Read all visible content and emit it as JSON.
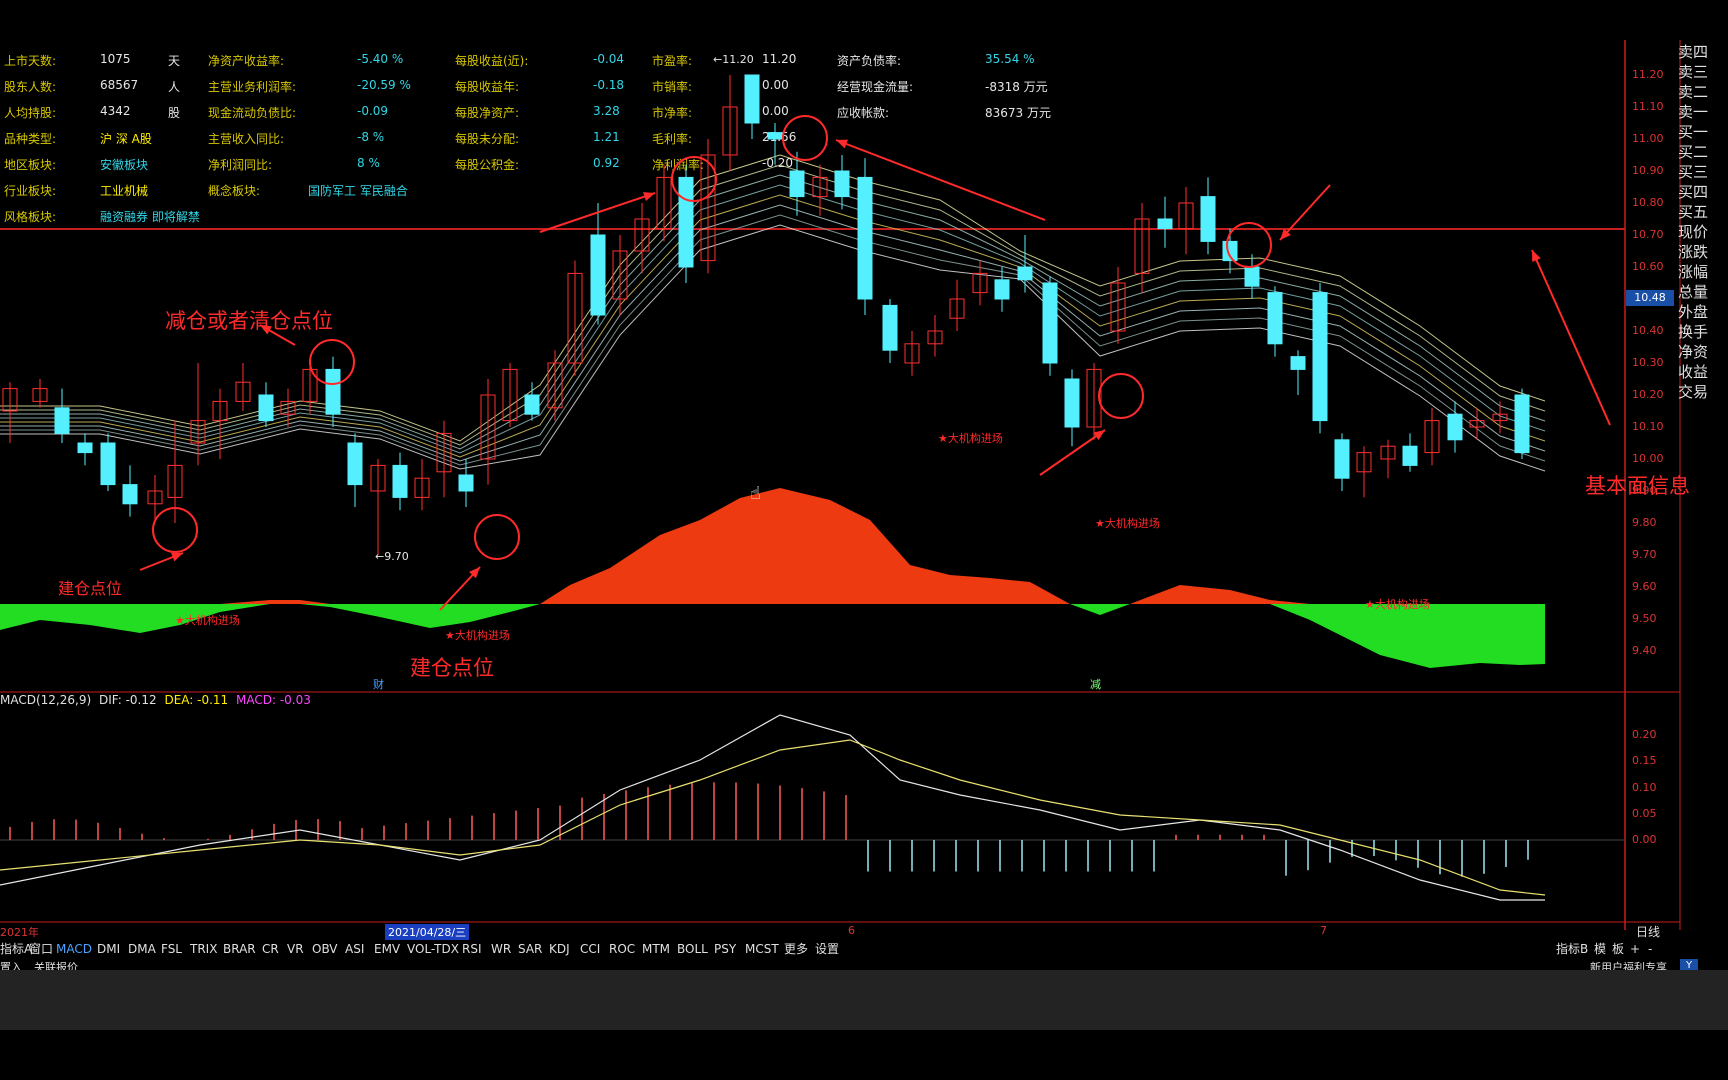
{
  "info_rows": [
    {
      "l1": "上市天数:",
      "v1": "1075",
      "u1": "天",
      "l2": "净资产收益率:",
      "v2": "-5.40 %",
      "l3": "每股收益(近):",
      "v3": "-0.04",
      "l4": "市盈率:",
      "v4": "11.20",
      "l5": "资产负债率:",
      "v5": "35.54 %"
    },
    {
      "l1": "股东人数:",
      "v1": "68567",
      "u1": "人",
      "l2": "主营业务利润率:",
      "v2": "-20.59 %",
      "l3": "每股收益年:",
      "v3": "-0.18",
      "l4": "市销率:",
      "v4": "0.00",
      "l5": "经营现金流量:",
      "v5": "-8318 万元"
    },
    {
      "l1": "人均持股:",
      "v1": "4342",
      "u1": "股",
      "l2": "现金流动负债比:",
      "v2": "-0.09",
      "l3": "每股净资产:",
      "v3": "3.28",
      "l4": "市净率:",
      "v4": "0.00",
      "l5": "应收帐款:",
      "v5": "83673 万元"
    },
    {
      "l1": "品种类型:",
      "v1": "沪 深 A股",
      "u1": "",
      "l2": "主营收入同比:",
      "v2": "-8 %",
      "l3": "每股未分配:",
      "v3": "1.21",
      "l4": "毛利率:",
      "v4": "21.56",
      "l5": "",
      "v5": ""
    },
    {
      "l1": "地区板块:",
      "v1": "安徽板块",
      "u1": "",
      "l2": "净利润同比:",
      "v2": "8 %",
      "l3": "每股公积金:",
      "v3": "0.92",
      "l4": "净利润率:",
      "v4": "-0.20",
      "l5": "",
      "v5": ""
    },
    {
      "l1": "行业板块:",
      "v1": "工业机械",
      "u1": "",
      "l2": "概念板块:",
      "v2": "国防军工 军民融合",
      "l3": "",
      "v3": "",
      "l4": "",
      "v4": "",
      "l5": "",
      "v5": ""
    },
    {
      "l1": "风格板块:",
      "v1": "融资融券 即将解禁",
      "u1": "",
      "l2": "",
      "v2": "",
      "l3": "",
      "v3": "",
      "l4": "",
      "v4": "",
      "l5": "",
      "v5": ""
    }
  ],
  "annotations": {
    "reduce": "减仓或者清仓点位",
    "build1": "建仓点位",
    "build2": "建仓点位",
    "fundamentals": "基本面信息",
    "inst1": "★大机构进场",
    "inst2": "★大机构进场",
    "inst3": "★大机构进场",
    "inst4": "★大机构进场",
    "inst5": "★大机构进场",
    "low_label": "←9.70",
    "high_label": "←11.20"
  },
  "price_axis": [
    "11.20",
    "11.10",
    "11.00",
    "10.90",
    "10.80",
    "10.70",
    "10.60",
    "10.50",
    "10.40",
    "10.30",
    "10.20",
    "10.10",
    "10.00",
    "9.90",
    "9.80",
    "9.70",
    "9.60",
    "9.50",
    "9.40"
  ],
  "current_price": "10.48",
  "macd_axis": [
    "0.20",
    "0.15",
    "0.10",
    "0.05",
    "0.00"
  ],
  "macd_header": {
    "name": "MACD(12,26,9)",
    "dif": "DIF: -0.12",
    "dea": "DEA: -0.11",
    "macd": "MACD: -0.03"
  },
  "markers": {
    "cai": "财",
    "jian": "减"
  },
  "date_axis": {
    "start": "2021年",
    "selected": "2021/04/28/三",
    "m6": "6",
    "m7": "7",
    "period": "日线"
  },
  "right_labels": [
    "卖四",
    "卖三",
    "卖二",
    "卖一",
    "买一",
    "买二",
    "买三",
    "买四",
    "买五",
    "现价",
    "涨跌",
    "涨幅",
    "总量",
    "外盘",
    "换手",
    "净资",
    "收益",
    "交易"
  ],
  "tabs": [
    "指标A",
    "窗口",
    "MACD",
    "DMI",
    "DMA",
    "FSL",
    "TRIX",
    "BRAR",
    "CR",
    "VR",
    "OBV",
    "ASI",
    "EMV",
    "VOL-TDX",
    "RSI",
    "WR",
    "SAR",
    "KDJ",
    "CCI",
    "ROC",
    "MTM",
    "BOLL",
    "PSY",
    "MCST",
    "更多",
    "设置"
  ],
  "tabs_right": [
    "指标B",
    "模",
    "板",
    "+",
    "-"
  ],
  "status": {
    "left1": "置入",
    "left2": "关联报价",
    "right": "新用户福利专享"
  },
  "colors": {
    "up": "#ff3030",
    "down": "#55f0ff",
    "hist_up": "#ee3a10",
    "hist_down": "#22dd22",
    "frame": "#c81e1e"
  }
}
